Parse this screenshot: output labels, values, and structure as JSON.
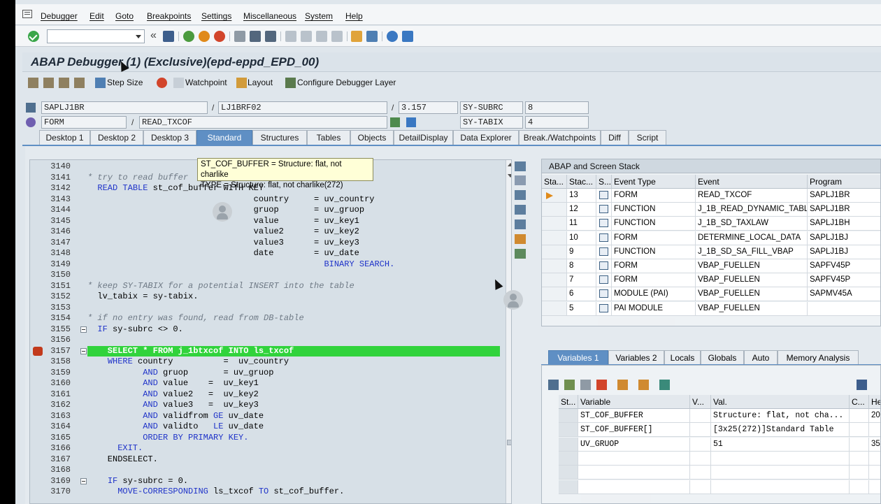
{
  "menu": [
    "Debugger",
    "Edit",
    "Goto",
    "Breakpoints",
    "Settings",
    "Miscellaneous",
    "System",
    "Help"
  ],
  "title": "ABAP Debugger (1)  (Exclusive)(epd-eppd_EPD_00)",
  "toolbar": {
    "step_size": "Step Size",
    "watchpoint": "Watchpoint",
    "layout": "Layout",
    "configure": "Configure Debugger Layer"
  },
  "fields": {
    "program": "SAPLJ1BR",
    "include": "LJ1BRF02",
    "line": "3.157",
    "sy_subrc_label": "SY-SUBRC",
    "sy_subrc_value": "8",
    "event_type": "FORM",
    "event": "READ_TXCOF",
    "sy_tabix_label": "SY-TABIX",
    "sy_tabix_value": "4",
    "sep1": "/",
    "sep2": "/",
    "sep3": "/"
  },
  "tabs": [
    "Desktop 1",
    "Desktop 2",
    "Desktop 3",
    "Standard",
    "Structures",
    "Tables",
    "Objects",
    "DetailDisplay",
    "Data Explorer",
    "Break./Watchpoints",
    "Diff",
    "Script"
  ],
  "active_tab": "Standard",
  "tooltip": {
    "line1": "ST_COF_BUFFER = Structure: flat, not charlike",
    "line2": "TYPE  = Structure: flat, not charlike(272)"
  },
  "code": [
    {
      "ln": "3140",
      "text": "",
      "type": "tx"
    },
    {
      "ln": "3141",
      "text": "* try to read buffer",
      "type": "cm"
    },
    {
      "ln": "3142",
      "text": "  READ TABLE st_cof_buffer WITH KEY",
      "type": "mix",
      "kw": "  READ TABLE ",
      "rest": "st_cof_buffer ",
      "kw2": "WITH KEY"
    },
    {
      "ln": "3143",
      "text": "                                 country     = uv_country",
      "type": "tx"
    },
    {
      "ln": "3144",
      "text": "                                 gruop       = uv_gruop",
      "type": "tx"
    },
    {
      "ln": "3145",
      "text": "                                 value       = uv_key1",
      "type": "tx"
    },
    {
      "ln": "3146",
      "text": "                                 value2      = uv_key2",
      "type": "tx"
    },
    {
      "ln": "3147",
      "text": "                                 value3      = uv_key3",
      "type": "tx"
    },
    {
      "ln": "3148",
      "text": "                                 date        = uv_date",
      "type": "tx"
    },
    {
      "ln": "3149",
      "text": "                                               BINARY SEARCH.",
      "type": "kw"
    },
    {
      "ln": "3150",
      "text": "",
      "type": "tx"
    },
    {
      "ln": "3151",
      "text": "* keep SY-TABIX for a potential INSERT into the table",
      "type": "cm"
    },
    {
      "ln": "3152",
      "text": "  lv_tabix = sy-tabix.",
      "type": "tx"
    },
    {
      "ln": "3153",
      "text": "",
      "type": "tx"
    },
    {
      "ln": "3154",
      "text": "* if no entry was found, read from DB-table",
      "type": "cm"
    },
    {
      "ln": "3155",
      "text": "  IF sy-subrc <> 0.",
      "type": "kwtx"
    },
    {
      "ln": "3156",
      "text": "",
      "type": "tx"
    },
    {
      "ln": "3157",
      "text": "    SELECT * FROM j_1btxcof INTO ls_txcof",
      "type": "hl"
    },
    {
      "ln": "3158",
      "text": "    WHERE country          =  uv_country",
      "type": "kwtx"
    },
    {
      "ln": "3159",
      "text": "           AND gruop       = uv_gruop",
      "type": "kwtx"
    },
    {
      "ln": "3160",
      "text": "           AND value    =  uv_key1",
      "type": "kwtx"
    },
    {
      "ln": "3161",
      "text": "           AND value2   =  uv_key2",
      "type": "kwtx"
    },
    {
      "ln": "3162",
      "text": "           AND value3   =  uv_key3",
      "type": "kwtx"
    },
    {
      "ln": "3163",
      "text": "           AND validfrom GE uv_date",
      "type": "kwtx"
    },
    {
      "ln": "3164",
      "text": "           AND validto   LE uv_date",
      "type": "kwtx"
    },
    {
      "ln": "3165",
      "text": "           ORDER BY PRIMARY KEY.",
      "type": "kw"
    },
    {
      "ln": "3166",
      "text": "      EXIT.",
      "type": "kw"
    },
    {
      "ln": "3167",
      "text": "    ENDSELECT.",
      "type": "tx"
    },
    {
      "ln": "3168",
      "text": "",
      "type": "tx"
    },
    {
      "ln": "3169",
      "text": "    IF sy-subrc = 0.",
      "type": "kwtx"
    },
    {
      "ln": "3170",
      "text": "      MOVE-CORRESPONDING ls_txcof TO st_cof_buffer.",
      "type": "kwtx"
    }
  ],
  "stack": {
    "title": "ABAP and Screen Stack",
    "headers": [
      "Sta...",
      "Stac...",
      "S...",
      "Event Type",
      "Event",
      "Program"
    ],
    "rows": [
      {
        "level": "13",
        "type": "FORM",
        "event": "READ_TXCOF",
        "program": "SAPLJ1BR",
        "current": true
      },
      {
        "level": "12",
        "type": "FUNCTION",
        "event": "J_1B_READ_DYNAMIC_TABLE",
        "program": "SAPLJ1BR",
        "current": false
      },
      {
        "level": "11",
        "type": "FUNCTION",
        "event": "J_1B_SD_TAXLAW",
        "program": "SAPLJ1BH",
        "current": false
      },
      {
        "level": "10",
        "type": "FORM",
        "event": "DETERMINE_LOCAL_DATA",
        "program": "SAPLJ1BJ",
        "current": false
      },
      {
        "level": "9",
        "type": "FUNCTION",
        "event": "J_1B_SD_SA_FILL_VBAP",
        "program": "SAPLJ1BJ",
        "current": false
      },
      {
        "level": "8",
        "type": "FORM",
        "event": "VBAP_FUELLEN",
        "program": "SAPFV45P",
        "current": false
      },
      {
        "level": "7",
        "type": "FORM",
        "event": "VBAP_FUELLEN",
        "program": "SAPFV45P",
        "current": false
      },
      {
        "level": "6",
        "type": "MODULE (PAI)",
        "event": "VBAP_FUELLEN",
        "program": "SAPMV45A",
        "current": false
      },
      {
        "level": "5",
        "type": "PAI MODULE",
        "event": "VBAP_FUELLEN",
        "program": "",
        "current": false
      }
    ]
  },
  "var_tabs": [
    "Variables 1",
    "Variables 2",
    "Locals",
    "Globals",
    "Auto",
    "Memory Analysis"
  ],
  "active_var_tab": "Variables 1",
  "vars": {
    "headers": [
      "St...",
      "Variable",
      "V...",
      "Val.",
      "C...",
      "He"
    ],
    "rows": [
      {
        "name": "ST_COF_BUFFER",
        "value": "Structure: flat, not cha...",
        "hex": "20"
      },
      {
        "name": "ST_COF_BUFFER[]",
        "value": "[3x25(272)]Standard Table",
        "hex": ""
      },
      {
        "name": "UV_GRUOP",
        "value": "51",
        "hex": "35"
      }
    ]
  },
  "colors": {
    "active_tab": "#5f8fc4",
    "current_line": "#31d33c",
    "keyword": "#1f33c9",
    "comment": "#6f7a86"
  }
}
